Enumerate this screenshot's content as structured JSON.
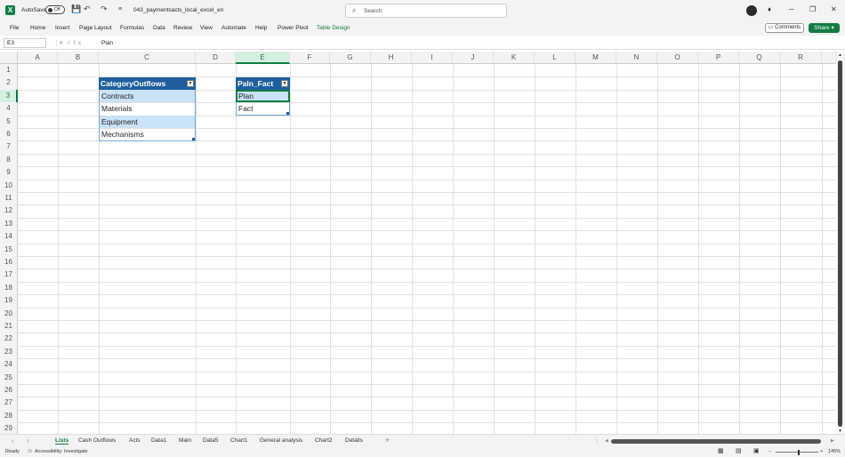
{
  "titlebar": {
    "autosave_label": "AutoSave",
    "autosave_state": "Off",
    "filename": "043_paymentsacts_local_excel_en",
    "search_placeholder": "Search",
    "minimize": "─",
    "restore": "❐",
    "close": "✕"
  },
  "menu": [
    "File",
    "Home",
    "Insert",
    "Page Layout",
    "Formulas",
    "Data",
    "Review",
    "View",
    "Automate",
    "Help",
    "Power Pivot",
    "Table Design"
  ],
  "actions": {
    "comments": "Comments",
    "share": "Share"
  },
  "formula": {
    "namebox": "E3",
    "content": "Plan"
  },
  "columns": [
    "A",
    "B",
    "C",
    "D",
    "E",
    "F",
    "G",
    "H",
    "I",
    "J",
    "K",
    "L",
    "M",
    "N",
    "O",
    "P",
    "Q",
    "R"
  ],
  "rows": [
    "1",
    "2",
    "3",
    "4",
    "5",
    "6",
    "7",
    "8",
    "9",
    "10",
    "11",
    "12",
    "13",
    "14",
    "15",
    "16",
    "17",
    "18",
    "19",
    "20",
    "21",
    "22",
    "23",
    "24",
    "25",
    "26",
    "27",
    "28",
    "29"
  ],
  "table1": {
    "header": "CategoryOutflows",
    "items": [
      "Contracts",
      "Materials",
      "Equipment",
      "Mechanisms"
    ]
  },
  "table2": {
    "header": "Paln_Fact",
    "items": [
      "Plan",
      "Fact"
    ]
  },
  "sheets": [
    "Lists",
    "Cash Outflows",
    "Acts",
    "Data1",
    "Main",
    "Data5",
    "Chart1",
    "General analysis",
    "Chart2",
    "Details"
  ],
  "active_sheet": "Lists",
  "status": {
    "ready": "Ready",
    "accessibility": "Accessibility: Investigate",
    "zoom": "145%"
  },
  "colors": {
    "accent": "#107c41",
    "table_header": "#1f5f9e",
    "table_band": "#c9e2f7"
  }
}
